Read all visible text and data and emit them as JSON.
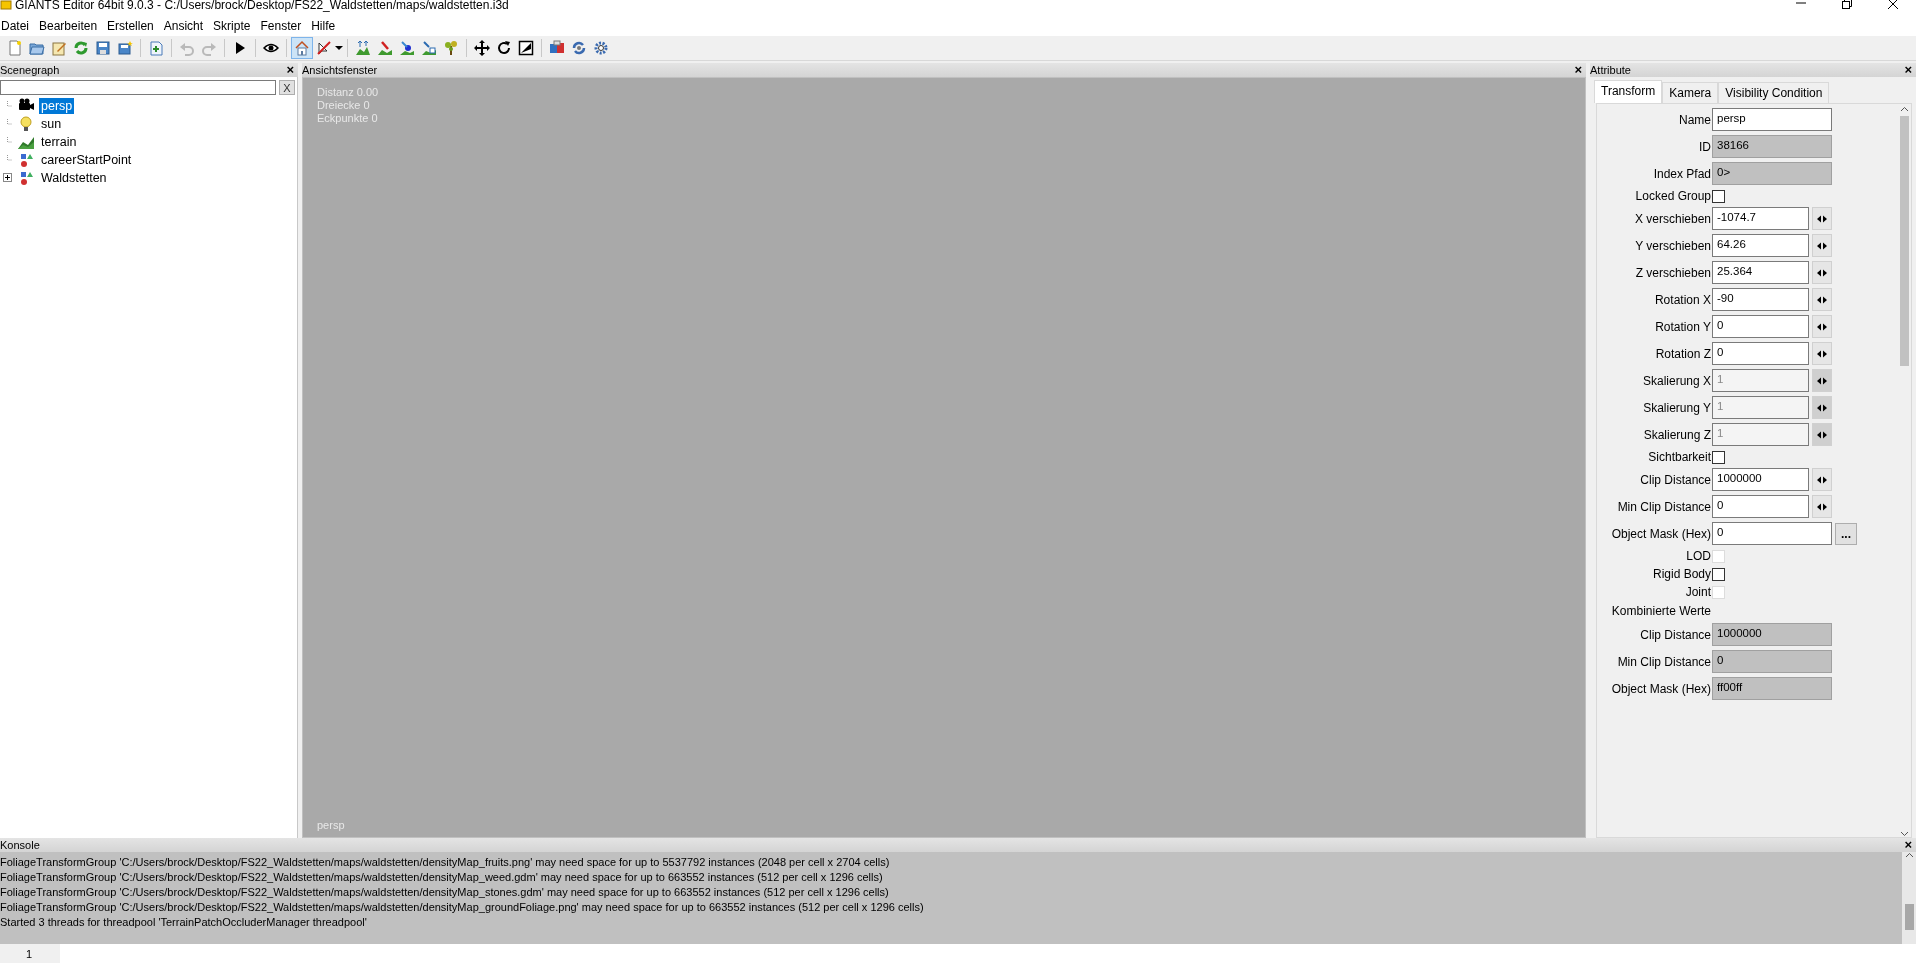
{
  "window": {
    "title": "GIANTS Editor 64bit 9.0.3 - C:/Users/brock/Desktop/FS22_Waldstetten/maps/waldstetten.i3d"
  },
  "menu": [
    "Datei",
    "Bearbeiten",
    "Erstellen",
    "Ansicht",
    "Skripte",
    "Fenster",
    "Hilfe"
  ],
  "toolbar": [
    {
      "kind": "new",
      "selected": false,
      "disabled": false
    },
    {
      "kind": "open",
      "selected": false,
      "disabled": false
    },
    {
      "kind": "edit",
      "selected": false,
      "disabled": false
    },
    {
      "kind": "reload",
      "selected": false,
      "disabled": false
    },
    {
      "kind": "save",
      "selected": false,
      "disabled": false
    },
    {
      "kind": "save-all",
      "selected": false,
      "disabled": false
    },
    {
      "kind": "separator"
    },
    {
      "kind": "import",
      "selected": false,
      "disabled": false
    },
    {
      "kind": "separator"
    },
    {
      "kind": "undo",
      "selected": false,
      "disabled": true
    },
    {
      "kind": "redo",
      "selected": false,
      "disabled": true
    },
    {
      "kind": "separator"
    },
    {
      "kind": "play",
      "selected": false,
      "disabled": false
    },
    {
      "kind": "separator"
    },
    {
      "kind": "eye",
      "selected": false,
      "disabled": false
    },
    {
      "kind": "separator"
    },
    {
      "kind": "home",
      "selected": true,
      "disabled": false
    },
    {
      "kind": "no-select",
      "selected": false,
      "disabled": false
    },
    {
      "kind": "separator"
    },
    {
      "kind": "terrain-up",
      "selected": false,
      "disabled": false
    },
    {
      "kind": "terrain-paint",
      "selected": false,
      "disabled": false
    },
    {
      "kind": "terrain-brush",
      "selected": false,
      "disabled": false
    },
    {
      "kind": "terrain-select",
      "selected": false,
      "disabled": false
    },
    {
      "kind": "foliage",
      "selected": false,
      "disabled": false
    },
    {
      "kind": "separator"
    },
    {
      "kind": "move",
      "selected": false,
      "disabled": false
    },
    {
      "kind": "rotate",
      "selected": false,
      "disabled": false
    },
    {
      "kind": "scale",
      "selected": false,
      "disabled": false
    },
    {
      "kind": "separator"
    },
    {
      "kind": "material",
      "selected": false,
      "disabled": false
    },
    {
      "kind": "refresh",
      "selected": false,
      "disabled": false
    },
    {
      "kind": "settings",
      "selected": false,
      "disabled": false
    }
  ],
  "scenegraph": {
    "title": "Scenegraph",
    "close": "×",
    "filter_clear": "X",
    "items": [
      {
        "label": "persp",
        "kind": "camera",
        "selected": true
      },
      {
        "label": "sun",
        "kind": "light",
        "selected": false
      },
      {
        "label": "terrain",
        "kind": "terrain",
        "selected": false
      },
      {
        "label": "careerStartPoint",
        "kind": "group",
        "selected": false
      },
      {
        "label": "Waldstetten",
        "kind": "group",
        "selected": false,
        "expanded": false
      }
    ]
  },
  "viewport": {
    "title": "Ansichtsfenster",
    "close": "×",
    "stats": [
      "Distanz 0.00",
      "Dreiecke 0",
      "Eckpunkte 0"
    ],
    "camera": "persp"
  },
  "attributes": {
    "title": "Attribute",
    "close": "×",
    "tabs": [
      {
        "label": "Transform",
        "selected": true
      },
      {
        "label": "Kamera",
        "selected": false
      },
      {
        "label": "Visibility Condition",
        "selected": false
      }
    ],
    "rows": [
      {
        "kind": "text",
        "label": "Name",
        "value": "persp"
      },
      {
        "kind": "readonly",
        "label": "ID",
        "value": "38166"
      },
      {
        "kind": "readonly",
        "label": "Index Pfad",
        "value": "0>"
      },
      {
        "kind": "checkbox",
        "label": "Locked Group",
        "checked": false,
        "disabled": false
      },
      {
        "kind": "spin",
        "label": "X verschieben",
        "value": "-1074.7",
        "disabled": false
      },
      {
        "kind": "spin",
        "label": "Y verschieben",
        "value": "64.26",
        "disabled": false
      },
      {
        "kind": "spin",
        "label": "Z verschieben",
        "value": "25.364",
        "disabled": false
      },
      {
        "kind": "spin",
        "label": "Rotation X",
        "value": "-90",
        "disabled": false
      },
      {
        "kind": "spin",
        "label": "Rotation Y",
        "value": "0",
        "disabled": false
      },
      {
        "kind": "spin",
        "label": "Rotation Z",
        "value": "0",
        "disabled": false
      },
      {
        "kind": "spin",
        "label": "Skalierung X",
        "value": "1",
        "disabled": true
      },
      {
        "kind": "spin",
        "label": "Skalierung Y",
        "value": "1",
        "disabled": true
      },
      {
        "kind": "spin",
        "label": "Skalierung Z",
        "value": "1",
        "disabled": true
      },
      {
        "kind": "checkbox",
        "label": "Sichtbarkeit",
        "checked": false,
        "disabled": false
      },
      {
        "kind": "spin",
        "label": "Clip Distance",
        "value": "1000000",
        "disabled": false
      },
      {
        "kind": "spin",
        "label": "Min Clip Distance",
        "value": "0",
        "disabled": false
      },
      {
        "kind": "button",
        "label": "Object Mask (Hex)",
        "value": "0",
        "button": "..."
      },
      {
        "kind": "checkbox",
        "label": "LOD",
        "checked": false,
        "disabled": true
      },
      {
        "kind": "checkbox",
        "label": "Rigid Body",
        "checked": false,
        "disabled": false
      },
      {
        "kind": "checkbox",
        "label": "Joint",
        "checked": false,
        "disabled": true
      },
      {
        "kind": "heading",
        "label": "Kombinierte Werte"
      },
      {
        "kind": "readonly",
        "label": "Clip Distance",
        "value": "1000000"
      },
      {
        "kind": "readonly",
        "label": "Min Clip Distance",
        "value": "0"
      },
      {
        "kind": "readonly",
        "label": "Object Mask (Hex)",
        "value": "ff00ff"
      }
    ]
  },
  "console": {
    "title": "Konsole",
    "close": "×",
    "lines": [
      "FoliageTransformGroup 'C:/Users/brock/Desktop/FS22_Waldstetten/maps/waldstetten/densityMap_fruits.png' may need space for up to 5537792 instances (2048 per cell x 2704 cells)",
      "FoliageTransformGroup 'C:/Users/brock/Desktop/FS22_Waldstetten/maps/waldstetten/densityMap_weed.gdm' may need space for up to 663552 instances (512 per cell x 1296 cells)",
      "FoliageTransformGroup 'C:/Users/brock/Desktop/FS22_Waldstetten/maps/waldstetten/densityMap_stones.gdm' may need space for up to 663552 instances (512 per cell x 1296 cells)",
      "FoliageTransformGroup 'C:/Users/brock/Desktop/FS22_Waldstetten/maps/waldstetten/densityMap_groundFoliage.png' may need space for up to 663552 instances (512 per cell x 1296 cells)",
      "Started 3 threads for threadpool 'TerrainPatchOccluderManager threadpool'"
    ],
    "input_line_number": "1"
  }
}
